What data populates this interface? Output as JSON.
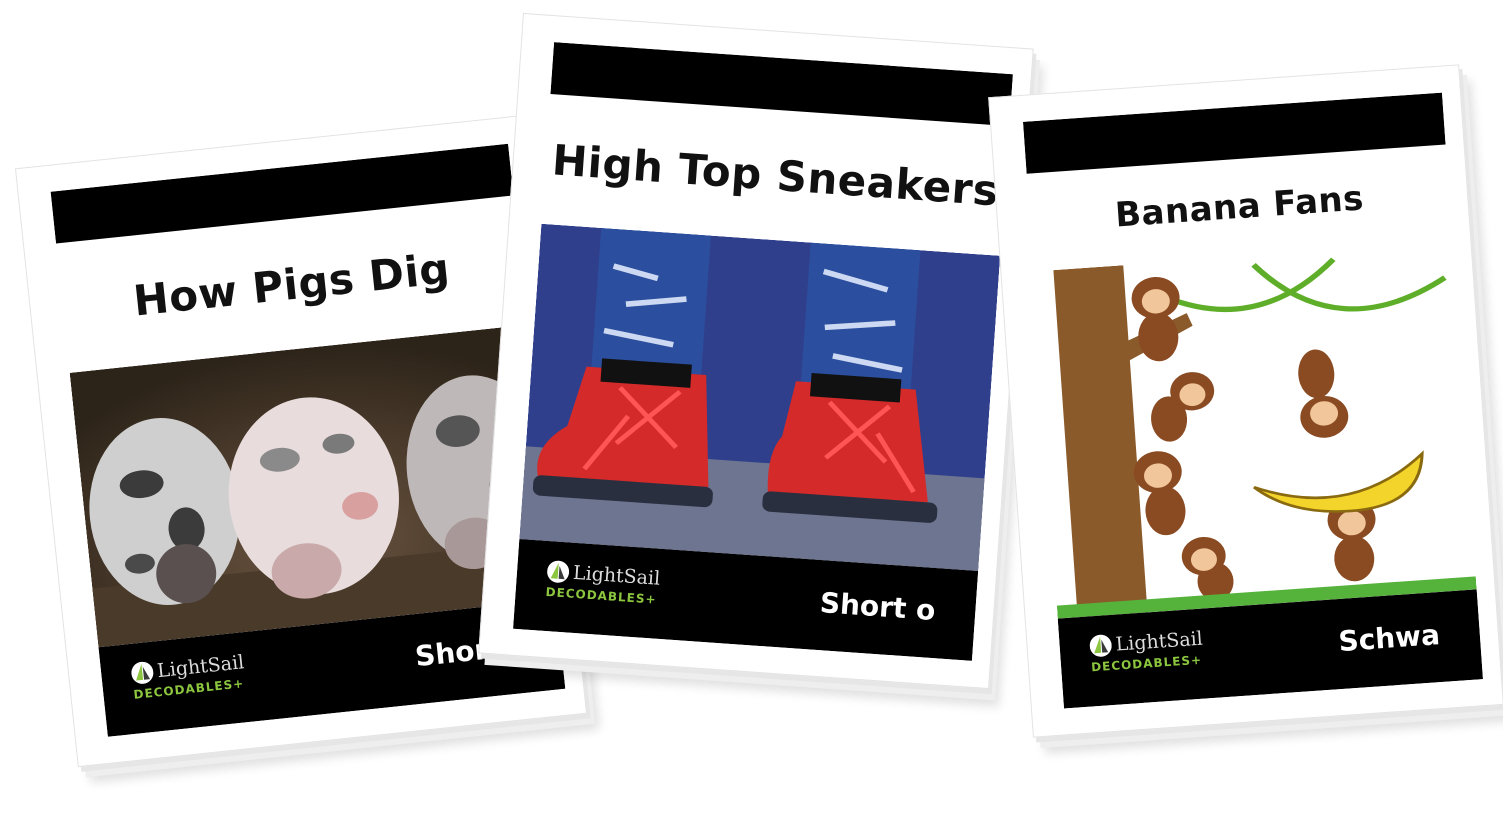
{
  "books": [
    {
      "title": "How Pigs Dig",
      "level": "Short i",
      "brand": "LightSail",
      "series": "DECODABLES+",
      "cover_art": "piglets-rooting-in-dirt",
      "title_color": "#111111"
    },
    {
      "title": "High Top Sneakers",
      "level": "Short o",
      "brand": "LightSail",
      "series": "DECODABLES+",
      "cover_art": "red-high-top-sneakers-and-jeans",
      "title_color": "#111111"
    },
    {
      "title": "Banana Fans",
      "level": "Schwa",
      "brand": "LightSail",
      "series": "DECODABLES+",
      "cover_art": "cartoon-monkeys-with-banana",
      "title_color": "#111111"
    }
  ],
  "colors": {
    "bar": "#000000",
    "series_green": "#8cc63f",
    "sneaker_red": "#d42a2a",
    "denim": "#2b4f9e"
  }
}
